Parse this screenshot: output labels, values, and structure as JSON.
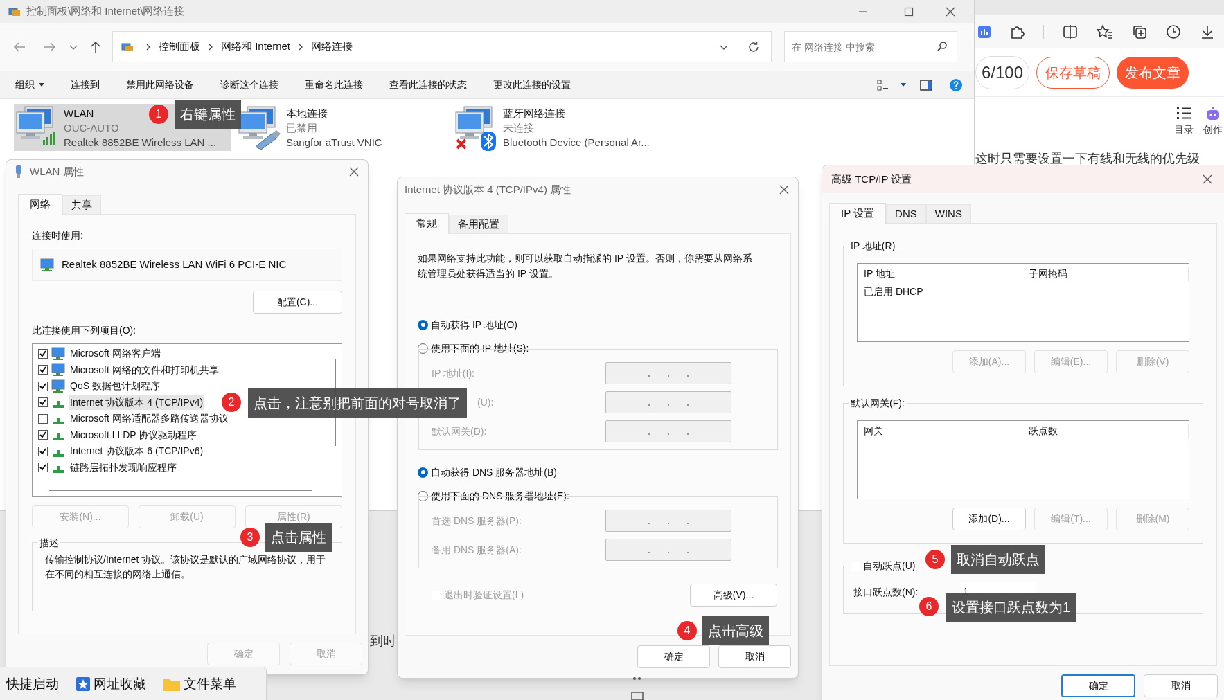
{
  "explorer": {
    "title": "控制面板\\网络和 Internet\\网络连接",
    "breadcrumb": [
      "控制面板",
      "网络和 Internet",
      "网络连接"
    ],
    "search": {
      "placeholder": "在 网络连接 中搜索"
    },
    "commands": [
      "组织",
      "连接到",
      "禁用此网络设备",
      "诊断这个连接",
      "重命名此连接",
      "查看此连接的状态",
      "更改此连接的设置"
    ],
    "connections": [
      {
        "name": "WLAN",
        "status": "OUC-AUTO",
        "device": "Realtek 8852BE Wireless LAN ...",
        "selected": true,
        "kind": "wifi"
      },
      {
        "name": "本地连接",
        "status": "已禁用",
        "device": "Sangfor aTrust VNIC",
        "selected": false,
        "kind": "cable"
      },
      {
        "name": "蓝牙网络连接",
        "status": "未连接",
        "device": "Bluetooth Device (Personal Ar...",
        "selected": false,
        "kind": "bluetooth"
      }
    ]
  },
  "browser": {
    "counter": "6/100",
    "buttons": [
      {
        "label": "保存草稿",
        "kind": "outline"
      },
      {
        "label": "发布文章",
        "kind": "filled"
      }
    ],
    "tools": [
      {
        "label": "目录",
        "kind": "outline"
      },
      {
        "label": "创作",
        "kind": "robot"
      }
    ],
    "article_text": "这时只需要设置一下有线和无线的优先级"
  },
  "background_text": "到时",
  "wlan_dialog": {
    "title": "WLAN 属性",
    "tabs": [
      {
        "label": "网络",
        "selected": true
      },
      {
        "label": "共享",
        "selected": false
      }
    ],
    "connect_using_label": "连接时使用:",
    "adapter": "Realtek 8852BE Wireless LAN WiFi 6 PCI-E NIC",
    "configure_button": "配置(C)...",
    "items_label": "此连接使用下列项目(O):",
    "items": [
      {
        "label": "Microsoft 网络客户端",
        "checked": true,
        "selected": false,
        "kind": "service"
      },
      {
        "label": "Microsoft 网络的文件和打印机共享",
        "checked": true,
        "selected": false,
        "kind": "service"
      },
      {
        "label": "QoS 数据包计划程序",
        "checked": true,
        "selected": false,
        "kind": "service"
      },
      {
        "label": "Internet 协议版本 4 (TCP/IPv4)",
        "checked": true,
        "selected": true,
        "kind": "protocol"
      },
      {
        "label": "Microsoft 网络适配器多路传送器协议",
        "checked": false,
        "selected": false,
        "kind": "protocol"
      },
      {
        "label": "Microsoft LLDP 协议驱动程序",
        "checked": true,
        "selected": false,
        "kind": "protocol"
      },
      {
        "label": "Internet 协议版本 6 (TCP/IPv6)",
        "checked": true,
        "selected": false,
        "kind": "protocol"
      },
      {
        "label": "链路层拓扑发现响应程序",
        "checked": true,
        "selected": false,
        "kind": "protocol"
      }
    ],
    "item_buttons": [
      {
        "label": "安装(N)...",
        "disabled": true
      },
      {
        "label": "卸载(U)",
        "disabled": true
      },
      {
        "label": "属性(R)",
        "disabled": true
      }
    ],
    "description_label": "描述",
    "description": "传输控制协议/Internet 协议。该协议是默认的广域网络协议，用于在不同的相互连接的网络上通信。",
    "buttons": [
      {
        "label": "确定",
        "disabled": true
      },
      {
        "label": "取消",
        "disabled": true
      }
    ]
  },
  "ipv4_dialog": {
    "title": "Internet 协议版本 4 (TCP/IPv4) 属性",
    "tabs": [
      {
        "label": "常规",
        "selected": true
      },
      {
        "label": "备用配置",
        "selected": false
      }
    ],
    "intro": "如果网络支持此功能，则可以获取自动指派的 IP 设置。否则，你需要从网络系统管理员处获得适当的 IP 设置。",
    "ip_options": [
      {
        "label": "自动获得 IP 地址(O)",
        "selected": true
      },
      {
        "label": "使用下面的 IP 地址(S):",
        "selected": false
      }
    ],
    "ip_fields": [
      {
        "label": "IP 地址(I):"
      },
      {
        "label": "(U):",
        "partial": true
      },
      {
        "label": "默认网关(D):"
      }
    ],
    "dns_options": [
      {
        "label": "自动获得 DNS 服务器地址(B)",
        "selected": true
      },
      {
        "label": "使用下面的 DNS 服务器地址(E):",
        "selected": false
      }
    ],
    "dns_fields": [
      {
        "label": "首选 DNS 服务器(P):"
      },
      {
        "label": "备用 DNS 服务器(A):"
      }
    ],
    "validate": {
      "label": "退出时验证设置(L)",
      "checked": false
    },
    "advanced_button": "高级(V)...",
    "buttons": [
      "确定",
      "取消"
    ]
  },
  "advanced_dialog": {
    "title": "高级 TCP/IP 设置",
    "tabs": [
      {
        "label": "IP 设置",
        "selected": true
      },
      {
        "label": "DNS",
        "selected": false
      },
      {
        "label": "WINS",
        "selected": false
      }
    ],
    "ip_group": "IP 地址(R)",
    "ip_columns": [
      "IP 地址",
      "子网掩码"
    ],
    "ip_rows": [
      "已启用 DHCP"
    ],
    "ip_buttons": [
      {
        "label": "添加(A)...",
        "disabled": true
      },
      {
        "label": "编辑(E)...",
        "disabled": true
      },
      {
        "label": "删除(V)",
        "disabled": true
      }
    ],
    "gateway_group": "默认网关(F):",
    "gateway_columns": [
      "网关",
      "跃点数"
    ],
    "gateway_buttons": [
      {
        "label": "添加(D)...",
        "disabled": false
      },
      {
        "label": "编辑(T)...",
        "disabled": true
      },
      {
        "label": "删除(M)",
        "disabled": true
      }
    ],
    "auto_metric": {
      "label": "自动跃点(U)",
      "checked": false
    },
    "metric_label": "接口跃点数(N):",
    "metric_value": "1",
    "buttons": [
      "确定",
      "取消"
    ]
  },
  "annotations": [
    {
      "number": "1",
      "text": "右键属性"
    },
    {
      "number": "2",
      "text": "点击，注意别把前面的对号取消了"
    },
    {
      "number": "3",
      "text": "点击属性"
    },
    {
      "number": "4",
      "text": "点击高级"
    },
    {
      "number": "5",
      "text": "取消自动跃点"
    },
    {
      "number": "6",
      "text": "设置接口跃点数为1"
    }
  ],
  "taskbar": [
    {
      "label": "快捷启动",
      "kind": "plain"
    },
    {
      "label": "网址收藏",
      "kind": "star"
    },
    {
      "label": "文件菜单",
      "kind": "folder"
    }
  ]
}
